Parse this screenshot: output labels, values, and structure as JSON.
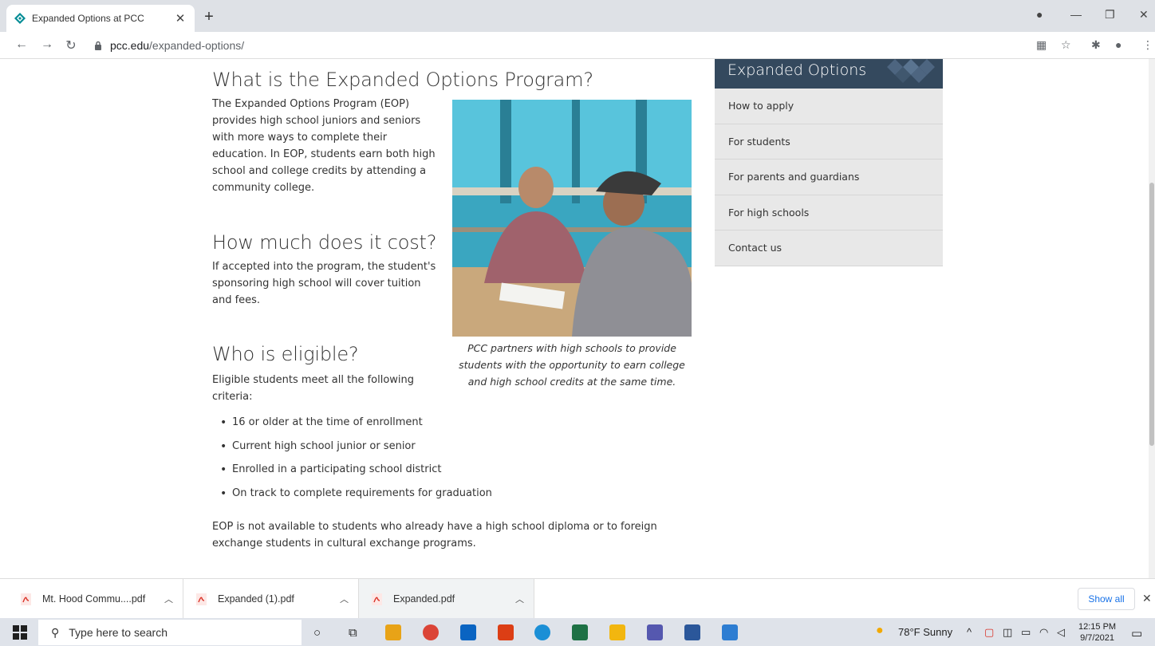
{
  "browser": {
    "tab_title": "Expanded Options at PCC",
    "url_host": "pcc.edu",
    "url_path": "/expanded-options/"
  },
  "main": {
    "sections": [
      {
        "heading": "What is the Expanded Options Program?",
        "text": "The Expanded Options Program (EOP) provides high school juniors and seniors with more ways to complete their education. In EOP, students earn both high school and college credits by attending a community college."
      },
      {
        "heading": "How much does it cost?",
        "text": "If accepted into the program, the student's sponsoring high school will cover tuition and fees."
      },
      {
        "heading": "Who is eligible?",
        "text": "Eligible students meet all the following criteria:"
      }
    ],
    "criteria": [
      "16 or older at the time of enrollment",
      "Current high school junior or senior",
      "Enrolled in a participating school district",
      "On track to complete requirements for graduation"
    ],
    "note": "EOP is not available to students who already have a high school diploma or to foreign exchange students in cultural exchange programs.",
    "photo_caption": "PCC partners with high schools to provide students with the opportunity to earn college and high school credits at the same time."
  },
  "sidebar": {
    "title": "Expanded Options",
    "items": [
      "How to apply",
      "For students",
      "For parents and guardians",
      "For high schools",
      "Contact us"
    ]
  },
  "downloads": {
    "items": [
      "Mt. Hood Commu....pdf",
      "Expanded (1).pdf",
      "Expanded.pdf"
    ],
    "show_all": "Show all"
  },
  "taskbar": {
    "search_placeholder": "Type here to search",
    "weather": "78°F  Sunny",
    "time": "12:15 PM",
    "date": "9/7/2021"
  },
  "colors": {
    "sidebar_header": "#34495e",
    "sidebar_item": "#e8e8e8",
    "chrome_frame": "#dee1e6",
    "link_blue": "#1a73e8"
  }
}
